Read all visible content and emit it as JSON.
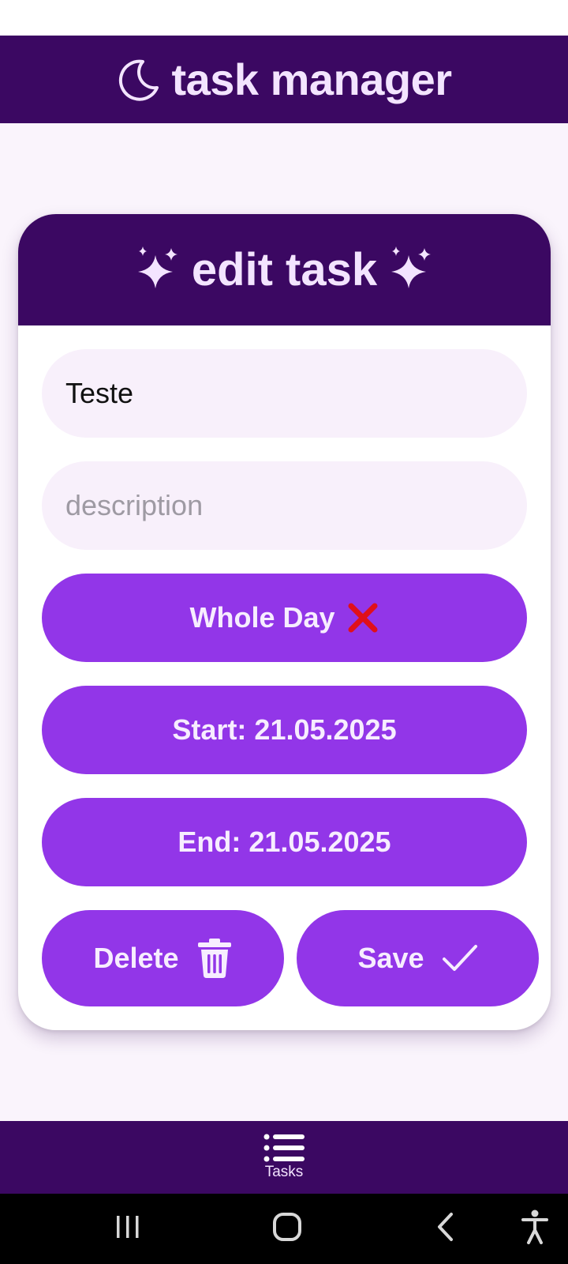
{
  "app": {
    "title": "task manager",
    "title_icon": "moon-icon"
  },
  "dialog": {
    "title": "edit task",
    "title_icons": [
      "sparkles-icon",
      "sparkles-icon"
    ],
    "title_field": {
      "value": "Teste"
    },
    "description_field": {
      "value": "",
      "placeholder": "description"
    },
    "whole_day_button": {
      "label": "Whole Day",
      "icon": "cross-mark-icon",
      "state": "off"
    },
    "start_button": {
      "label": "Start: 21.05.2025"
    },
    "end_button": {
      "label": "End: 21.05.2025"
    },
    "delete_button": {
      "label": "Delete",
      "icon": "trash-icon"
    },
    "save_button": {
      "label": "Save",
      "icon": "checkmark-icon"
    }
  },
  "bottom_nav": {
    "items": [
      {
        "label": "Tasks",
        "icon": "list-icon",
        "selected": true
      }
    ]
  },
  "system_nav": {
    "buttons": [
      "recents-icon",
      "home-icon",
      "back-icon",
      "accessibility-icon"
    ]
  },
  "colors": {
    "primary_dark": "#3b0862",
    "accent": "#9236e8",
    "background": "#faf4fc",
    "field_background": "#f8f0fb",
    "on_primary_text": "#f3e4ff",
    "cross_red": "#e0101a"
  }
}
